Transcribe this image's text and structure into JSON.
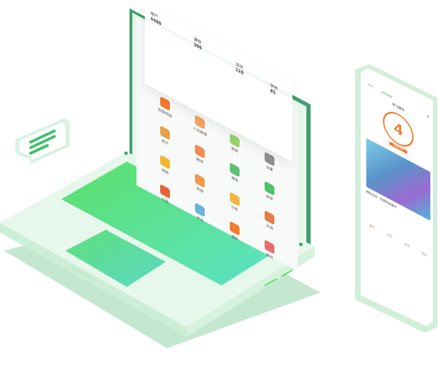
{
  "colors": {
    "brand_green": "#3fa06a",
    "light_green": "#d9f2e1",
    "touchpad_top": "#5be06a",
    "touchpad_bottom": "#5ce3c9",
    "accent_orange": "#f47a2c"
  },
  "floating_stats": [
    {
      "label": "用户",
      "value": "4400"
    },
    {
      "label": "课程",
      "value": "300"
    },
    {
      "label": "活动",
      "value": "120"
    },
    {
      "label": "学校",
      "value": "85"
    }
  ],
  "apps": [
    {
      "label": "智慧校园",
      "icon": "orange-monitor-icon",
      "color": "#f47a2c"
    },
    {
      "label": "人员管理",
      "icon": "person-icon",
      "color": "#f5a25c"
    },
    {
      "label": "报表",
      "icon": "chart-icon",
      "color": "#9bd36a"
    },
    {
      "label": "设置",
      "icon": "gear-icon",
      "color": "#8f8f8f"
    },
    {
      "label": "统计",
      "icon": "donut-icon",
      "color": "#e6a04a"
    },
    {
      "label": "教师",
      "icon": "teacher-icon",
      "color": "#f08d55"
    },
    {
      "label": "课堂",
      "icon": "clipboard-icon",
      "color": "#5fbf77"
    },
    {
      "label": "家校",
      "icon": "wechat-icon",
      "color": "#4fc06a"
    },
    {
      "label": "奖励",
      "icon": "trophy-icon",
      "color": "#f2b630"
    },
    {
      "label": "资源",
      "icon": "coins-icon",
      "color": "#f2994a"
    },
    {
      "label": "分析",
      "icon": "pie-icon",
      "color": "#f4b545"
    },
    {
      "label": "文档",
      "icon": "book-icon",
      "color": "#e87c4a"
    },
    {
      "label": "日程",
      "icon": "calendar-icon",
      "color": "#e8643a"
    },
    {
      "label": "考试",
      "icon": "test-icon",
      "color": "#6cb4e0"
    },
    {
      "label": "通知",
      "icon": "notice-icon",
      "color": "#f47a2c"
    },
    {
      "label": "帮助",
      "icon": "info-icon",
      "color": "#e46f6f"
    }
  ],
  "phone": {
    "status_time": "9:41",
    "title": "学习报告",
    "big_number": "4",
    "badge": "查看详情",
    "caption": "精彩活动 · 校园风采展示",
    "tabs": [
      "首页",
      "消息",
      "发现",
      "我的"
    ]
  }
}
